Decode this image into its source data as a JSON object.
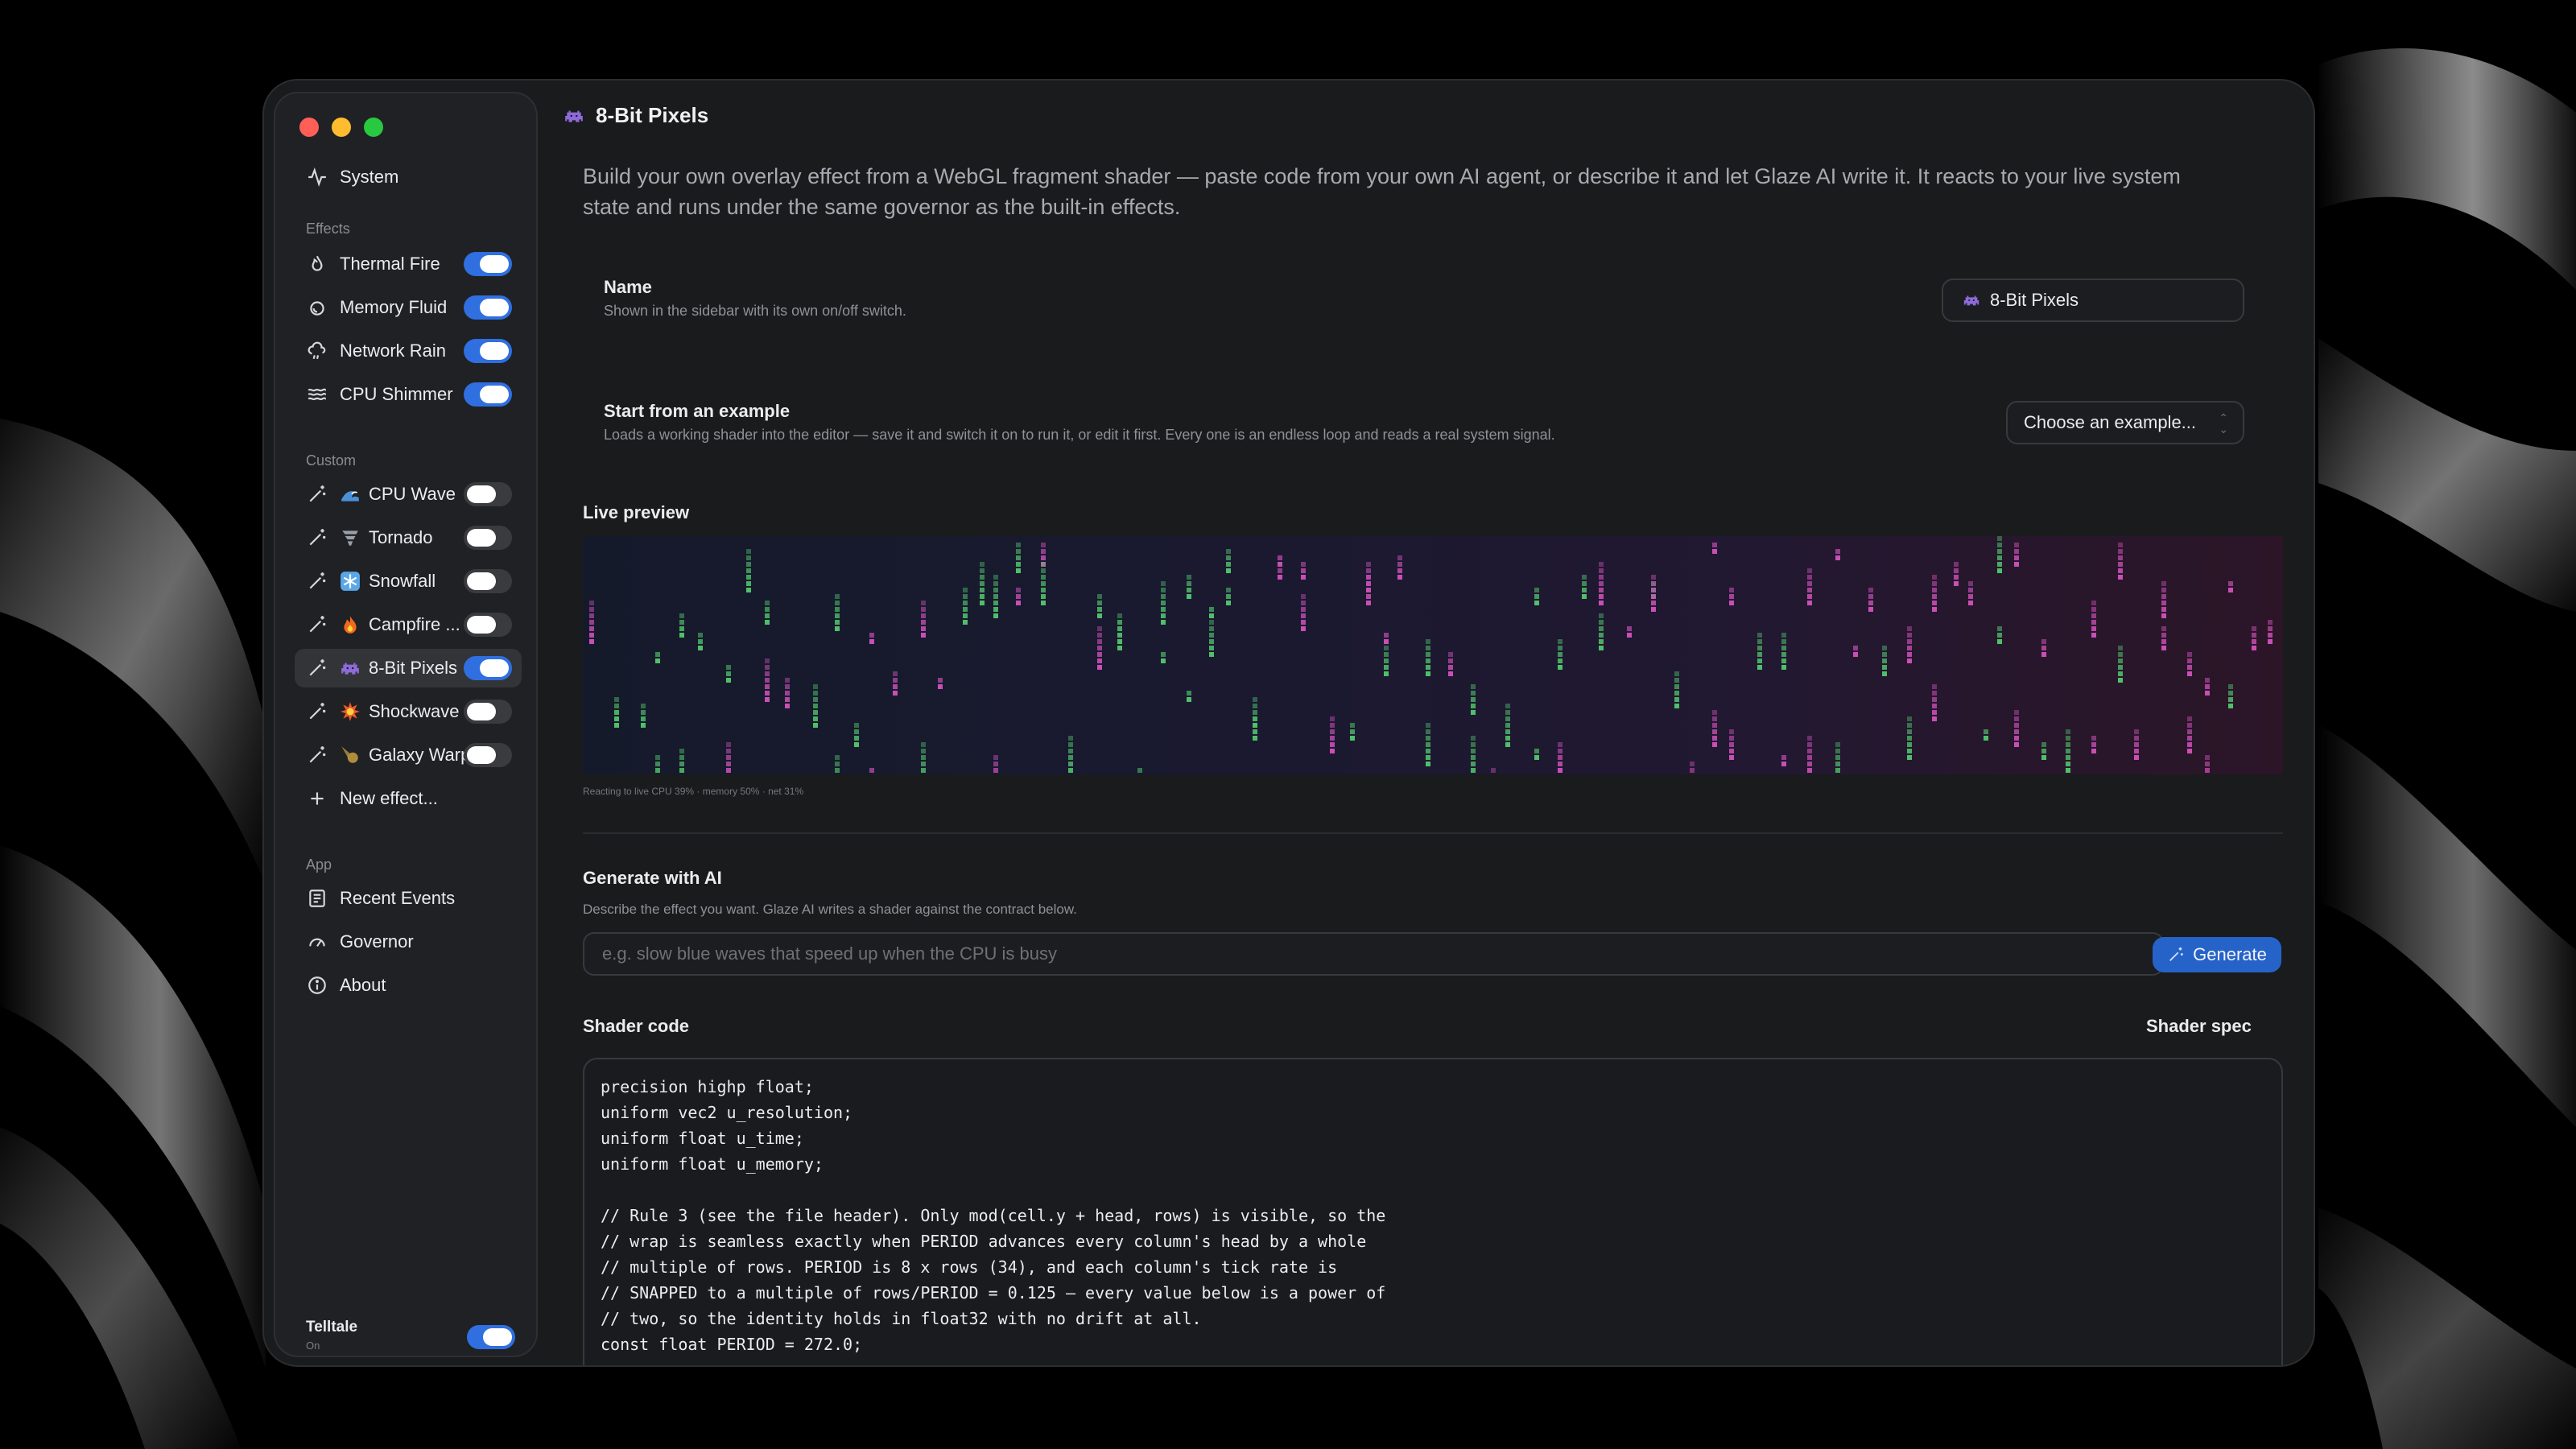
{
  "window": {
    "title": "8-Bit Pixels",
    "title_icon": "alien-monster-icon"
  },
  "sidebar": {
    "system": {
      "label": "System",
      "icon": "activity-icon"
    },
    "sections": {
      "effects": "Effects",
      "custom": "Custom",
      "app": "App"
    },
    "effects": [
      {
        "label": "Thermal Fire",
        "icon": "flame-icon",
        "enabled": true
      },
      {
        "label": "Memory Fluid",
        "icon": "fluid-icon",
        "enabled": true
      },
      {
        "label": "Network Rain",
        "icon": "cloud-rain-icon",
        "enabled": true
      },
      {
        "label": "CPU Shimmer",
        "icon": "waves-icon",
        "enabled": true
      }
    ],
    "custom": [
      {
        "label": "CPU Wave",
        "emoji": "wave-emoji",
        "enabled": false
      },
      {
        "label": "Tornado",
        "emoji": "tornado-emoji",
        "enabled": false
      },
      {
        "label": "Snowfall",
        "emoji": "snowflake-emoji",
        "enabled": false
      },
      {
        "label": "Campfire ...",
        "emoji": "fire-emoji",
        "enabled": false
      },
      {
        "label": "8-Bit Pixels",
        "emoji": "alien-monster-emoji",
        "enabled": true,
        "selected": true
      },
      {
        "label": "Shockwave",
        "emoji": "collision-emoji",
        "enabled": false
      },
      {
        "label": "Galaxy Warp",
        "emoji": "comet-emoji",
        "enabled": false
      }
    ],
    "new_effect": "New effect...",
    "app": [
      {
        "label": "Recent Events",
        "icon": "list-icon"
      },
      {
        "label": "Governor",
        "icon": "gauge-icon"
      },
      {
        "label": "About",
        "icon": "info-icon"
      }
    ],
    "telltale": {
      "label": "Telltale",
      "sub": "On",
      "enabled": true
    }
  },
  "main": {
    "intro": "Build your own overlay effect from a WebGL fragment shader — paste code from your own AI agent, or describe it and let Glaze AI write it. It reacts to your live system state and runs under the same governor as the built-in effects.",
    "name": {
      "title": "Name",
      "sub": "Shown in the sidebar with its own on/off switch.",
      "value": "8-Bit Pixels"
    },
    "example": {
      "title": "Start from an example",
      "sub": "Loads a working shader into the editor — save it and switch it on to run it, or edit it first. Every one is an endless loop and reads a real system signal.",
      "select_value": "Choose an example..."
    },
    "preview": {
      "title": "Live preview",
      "caption": "Reacting to live CPU 39% · memory 50% · net 31%"
    },
    "generate": {
      "title": "Generate with AI",
      "sub": "Describe the effect you want. Glaze AI writes a shader against the contract below.",
      "placeholder": "e.g. slow blue waves that speed up when the CPU is busy",
      "button": "Generate"
    },
    "shader": {
      "title": "Shader code",
      "spec_link": "Shader spec",
      "lines": [
        "precision highp float;",
        "uniform vec2 u_resolution;",
        "uniform float u_time;",
        "uniform float u_memory;",
        "",
        "// Rule 3 (see the file header). Only mod(cell.y + head, rows) is visible, so the",
        "// wrap is seamless exactly when PERIOD advances every column's head by a whole",
        "// multiple of rows. PERIOD is 8 x rows (34), and each column's tick rate is",
        "// SNAPPED to a multiple of rows/PERIOD = 0.125 — every value below is a power of",
        "// two, so the identity holds in float32 with no drift at all.",
        "const float PERIOD = 272.0;"
      ]
    }
  },
  "colors": {
    "accent": "#2f6fe0",
    "pixel_green": "#4fbf6a",
    "pixel_magenta": "#c94fb5"
  }
}
